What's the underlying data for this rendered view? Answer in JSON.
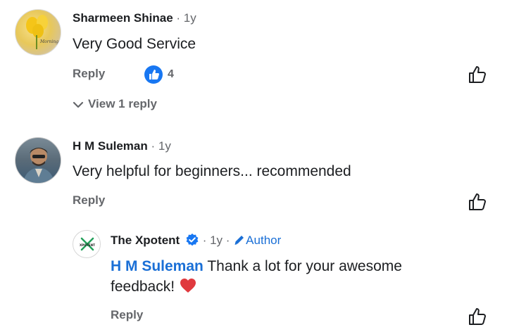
{
  "comments": [
    {
      "author": "Sharmeen Shinae",
      "time": "1y",
      "text": "Very Good Service",
      "reply_label": "Reply",
      "reaction_count": "4",
      "view_replies_label": "View 1 reply"
    },
    {
      "author": "H M Suleman",
      "time": "1y",
      "text": "Very helpful for beginners... recommended",
      "reply_label": "Reply",
      "replies": [
        {
          "author": "The Xpotent",
          "time": "1y",
          "author_badge": "Author",
          "mention": "H M Suleman",
          "text_line1": "Thank a lot for your awesome",
          "text_line2": "feedback!",
          "emoji": "❤️",
          "reply_label": "Reply",
          "avatar_text": "XPOTENT"
        }
      ]
    }
  ],
  "colors": {
    "link_blue": "#1a6fd6",
    "secondary_text": "#65676b",
    "like_blue": "#1877f2",
    "heart_red": "#e0393e"
  }
}
